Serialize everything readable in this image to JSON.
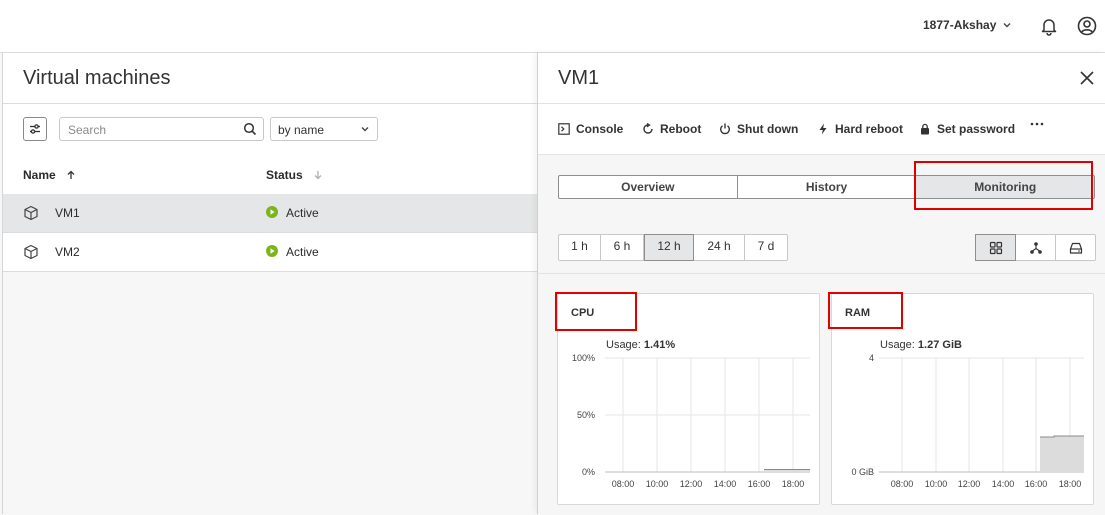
{
  "header": {
    "user": "1877-Akshay"
  },
  "left": {
    "title": "Virtual machines",
    "search_placeholder": "Search",
    "sort": "by name",
    "columns": {
      "name": "Name",
      "status": "Status"
    },
    "rows": [
      {
        "name": "VM1",
        "status": "Active",
        "selected": true
      },
      {
        "name": "VM2",
        "status": "Active",
        "selected": false
      }
    ]
  },
  "detail": {
    "title": "VM1",
    "actions": [
      "Console",
      "Reboot",
      "Shut down",
      "Hard reboot",
      "Set password"
    ],
    "tabs": [
      "Overview",
      "History",
      "Monitoring"
    ],
    "active_tab": "Monitoring",
    "ranges": [
      "1 h",
      "6 h",
      "12 h",
      "24 h",
      "7 d"
    ],
    "active_range": "12 h",
    "cpu": {
      "title": "CPU",
      "usage_label": "Usage:",
      "usage_value": "1.41%",
      "yticks": [
        "100%",
        "50%",
        "0%"
      ],
      "xticks": [
        "08:00",
        "10:00",
        "12:00",
        "14:00",
        "16:00",
        "18:00"
      ]
    },
    "ram": {
      "title": "RAM",
      "usage_label": "Usage:",
      "usage_value": "1.27 GiB",
      "yticks": [
        "4",
        "0 GiB"
      ],
      "xticks": [
        "08:00",
        "10:00",
        "12:00",
        "14:00",
        "16:00",
        "18:00"
      ]
    }
  },
  "colors": {
    "active_status": "#7cb518",
    "highlight": "#e00000"
  }
}
